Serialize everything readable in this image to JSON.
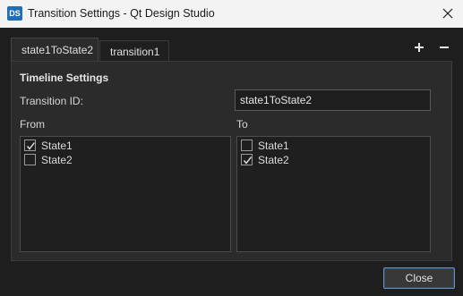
{
  "window": {
    "icon_text": "DS",
    "title": "Transition Settings - Qt Design Studio"
  },
  "tabs": [
    {
      "label": "state1ToState2",
      "active": true
    },
    {
      "label": "transition1",
      "active": false
    }
  ],
  "toolbar": {
    "add_label": "+",
    "remove_label": "−"
  },
  "panel": {
    "group_title": "Timeline Settings",
    "transition_id_label": "Transition ID:",
    "transition_id_value": "state1ToState2",
    "from_label": "From",
    "to_label": "To",
    "from_items": [
      {
        "label": "State1",
        "checked": true
      },
      {
        "label": "State2",
        "checked": false
      }
    ],
    "to_items": [
      {
        "label": "State1",
        "checked": false
      },
      {
        "label": "State2",
        "checked": true
      }
    ]
  },
  "footer": {
    "close_label": "Close"
  }
}
